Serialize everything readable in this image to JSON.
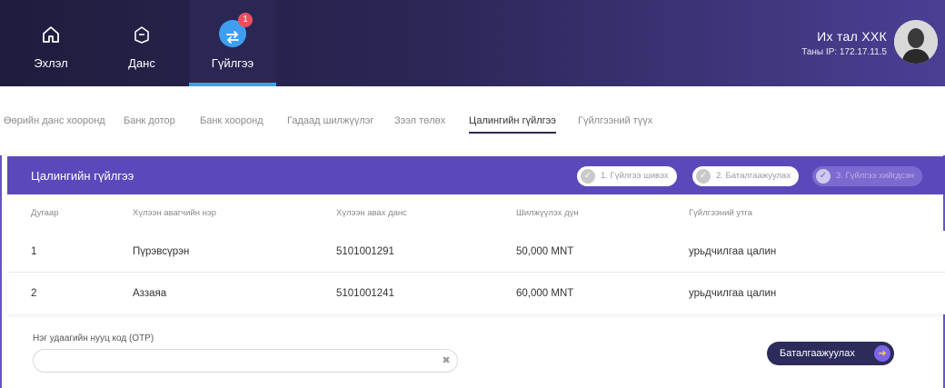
{
  "nav": {
    "items": [
      {
        "label": "Эхлэл",
        "icon": "home-icon"
      },
      {
        "label": "Данс",
        "icon": "wallet-icon"
      },
      {
        "label": "Гүйлгээ",
        "icon": "transfer-icon",
        "badge": "1"
      }
    ],
    "active_color": "#36a3ea"
  },
  "user": {
    "name": "Их тал ХХК",
    "ip": "Таны IP: 172.17.11.5"
  },
  "subtabs": [
    "Өөрийн данс хооронд",
    "Банк дотор",
    "Банк хооронд",
    "Гадаад шилжүүлэг",
    "Зээл төлөх",
    "Цалингийн гүйлгээ",
    "Гүйлгээний түүх"
  ],
  "panel": {
    "title": "Цалингийн гүйлгээ",
    "steps": [
      "1. Гүйлгээ шивэх",
      "2. Баталгаажуулах",
      "3. Гүйлгээ хийгдсэн"
    ]
  },
  "table": {
    "headers": [
      "Дугаар",
      "Хүлээн авагчийн нэр",
      "Хүлээн авах данс",
      "Шилжүүлэх дүн",
      "Гүйлгээний утга"
    ],
    "rows": [
      [
        "1",
        "Пүрэвсүрэн",
        "5101001291",
        "50,000 MNT",
        "урьдчилгаа цалин"
      ],
      [
        "2",
        "Аззаяа",
        "5101001241",
        "60,000 MNT",
        "урьдчилгаа цалин"
      ]
    ]
  },
  "otp": {
    "label": "Нэг удаагийн нууц код (OTP)",
    "value": "",
    "placeholder": ""
  },
  "confirm": {
    "label": "Баталгаажуулах"
  },
  "colors": {
    "brand_purple": "#5b49bb",
    "topbar_dark": "#1f1c3d",
    "accent_blue": "#3e9ff0",
    "badge_red": "#ef4d5e"
  }
}
